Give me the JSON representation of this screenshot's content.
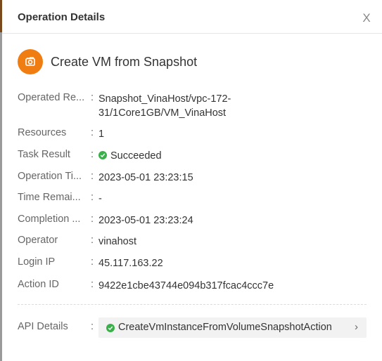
{
  "header": {
    "title": "Operation Details",
    "close_label": "X"
  },
  "operation": {
    "title": "Create VM from Snapshot",
    "icon": "snapshot-icon"
  },
  "details": [
    {
      "label": "Operated Re...",
      "value": "Snapshot_VinaHost/vpc-172-31/1Core1GB/VM_VinaHost"
    },
    {
      "label": "Resources",
      "value": "1"
    },
    {
      "label": "Task Result",
      "value": "Succeeded"
    },
    {
      "label": "Operation Ti...",
      "value": "2023-05-01 23:23:15"
    },
    {
      "label": "Time Remai...",
      "value": "-"
    },
    {
      "label": "Completion ...",
      "value": "2023-05-01 23:23:24"
    },
    {
      "label": "Operator",
      "value": "vinahost"
    },
    {
      "label": "Login IP",
      "value": "45.117.163.22"
    },
    {
      "label": "Action ID",
      "value": "9422e1cbe43744e094b317fcac4ccc7e"
    }
  ],
  "api": {
    "label": "API Details",
    "value": "CreateVmInstanceFromVolumeSnapshotAction",
    "chevron": "›"
  },
  "colors": {
    "accent": "#f07d12",
    "success": "#3bb04a"
  }
}
